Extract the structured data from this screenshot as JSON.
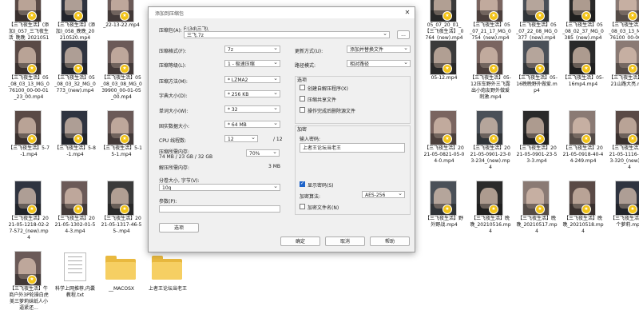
{
  "files": [
    {
      "name": "【三飞夜生活】(添加)_057_三飞夜生活_晚晚_20210518.mp4",
      "type": "video"
    },
    {
      "name": "【三飞夜生活】(添加)_058_晚晚_20210520.mp4",
      "type": "video"
    },
    {
      "name": "_22-13-22.mp4",
      "type": "video"
    },
    {
      "name": "05_07_20_01_【三飞夜生活】_0764_(new).mp4",
      "type": "video"
    },
    {
      "name": "【三飞夜生活】05_07_21_17_MG_0754_(new).mp4",
      "type": "video"
    },
    {
      "name": "【三飞夜生活】05_07_22_08_MG_0377_(new).mp4",
      "type": "video"
    },
    {
      "name": "【三飞夜生活】05_08_02_37_MG_0385_(new).mp4",
      "type": "video"
    },
    {
      "name": "【三飞夜生活】05_08_03_13_MG_076100_00-00-40_00.mp4",
      "type": "video"
    },
    {
      "name": "【三飞夜生活】05_08_03_13_MG_076100_00-00-01_23_00.mp4",
      "type": "video"
    },
    {
      "name": "【三飞夜生活】05_08_03_32_MG_0773_(new).mp4",
      "type": "video"
    },
    {
      "name": "【三飞夜生活】05_08_03_08_MG_039900_00-01-05_00.mp4",
      "type": "video"
    },
    {
      "name": "05-12.mp4",
      "type": "video"
    },
    {
      "name": "【三飞夜生活】05-12压车野外三飞露出小炮友野外做爱刺激.mp4",
      "type": "video"
    },
    {
      "name": "【三飞夜生活】05-16晚晚野外做爱.mp4",
      "type": "video"
    },
    {
      "name": "【三飞夜生活】05-16mp4.mp4",
      "type": "video"
    },
    {
      "name": "【三飞夜生活】05-21山路大亮.mp4",
      "type": "video"
    },
    {
      "name": "【三飞夜生活】5-7-1.mp4",
      "type": "video"
    },
    {
      "name": "【三飞夜生活】5-8-1.mp4",
      "type": "video"
    },
    {
      "name": "【三飞夜生活】5-15-1.mp4",
      "type": "video"
    },
    {
      "name": "【三飞夜生活】5-16.mp4",
      "type": "video"
    },
    {
      "name": "【三飞夜生活】2021-05-0821-05-04-0.mp4",
      "type": "video"
    },
    {
      "name": "【三飞夜生活】2021-05-0901-23-03-234_(new).mp4",
      "type": "video"
    },
    {
      "name": "【三飞夜生活】2021-05-0901-23-53-3.mp4",
      "type": "video"
    },
    {
      "name": "【三飞夜生活】2021-05-0918-40-44-249.mp4",
      "type": "video"
    },
    {
      "name": "【三飞夜生活】2021-05-1116-37-23-320_(new).mp4",
      "type": "video"
    },
    {
      "name": "【三飞夜生活】2021-05-1218-02-27-572_(new).mp4",
      "type": "video"
    },
    {
      "name": "【三飞夜生活】2021-05-1302-01-54-3.mp4",
      "type": "video"
    },
    {
      "name": "【三飞夜生活】2021-05-1317-46-55-.mp4",
      "type": "video"
    },
    {
      "name": "【三飞夜生活】42-5...",
      "type": "video"
    },
    {
      "name": "【三飞夜生活】野外野战.mp4",
      "type": "video"
    },
    {
      "name": "【三飞夜生活】晚晚_20210516.mp4",
      "type": "video"
    },
    {
      "name": "【三飞夜生活】晚晚_20210517.mp4",
      "type": "video"
    },
    {
      "name": "【三飞夜生活】晚晚_20210518.mp4",
      "type": "video"
    },
    {
      "name": "【三飞夜生活】三个萝莉.mp4",
      "type": "video"
    },
    {
      "name": "【三飞夜生活】牛商户外3P轮操白虎美三萝莉妹纸人小逼紧还...",
      "type": "video"
    },
    {
      "name": "科学上网推荐,内囊教程.txt",
      "type": "doc"
    },
    {
      "name": "__MACOSX",
      "type": "folder"
    },
    {
      "name": "上者王论坛当老王",
      "type": "folder"
    }
  ],
  "dialog": {
    "title": "添加到压缩包",
    "close_icon": "close-icon",
    "archive_label": "压缩包(A):",
    "archive_path": "F:\\3d\\三飞\\",
    "archive_name": "三飞.7z",
    "browse_label": "...",
    "format_label": "压缩格式(F):",
    "format_value": "7z",
    "level_label": "压缩等级(L):",
    "level_value": "1 - 极速压缩",
    "method_label": "压缩方法(M):",
    "method_value": "* LZMA2",
    "dict_label": "字典大小(D):",
    "dict_value": "* 256 KB",
    "word_label": "单词大小(W):",
    "word_value": "* 32",
    "solid_label": "固实数据大小:",
    "solid_value": "* 64 MB",
    "cpu_label": "CPU 线程数:",
    "cpu_value": "12",
    "cpu_max": "/ 12",
    "mem_label": "压缩所需内存:",
    "mem_detail": "74 MB / 23 GB / 32 GB",
    "mem_percent": "70%",
    "decomp_label": "解压所需内存:",
    "decomp_value": "3 MB",
    "split_label": "分卷大小, 字节(V):",
    "split_value": "10g",
    "params_label": "参数(P):",
    "params_value": "",
    "options_button": "选项",
    "update_label": "更新方式(U):",
    "update_value": "添加并替换文件",
    "pathmode_label": "路径模式:",
    "pathmode_value": "相对路径",
    "options_group": "选项",
    "opt_sfx": "创建自解压程序(X)",
    "opt_shared": "压缩共享文件",
    "opt_delete": "操作完成后删除源文件",
    "encrypt_group": "加密",
    "password_label": "输入密码:",
    "password_value": "上者王论坛当老王",
    "show_password": "显示密码(S)",
    "show_password_checked": true,
    "method_enc_label": "加密算法:",
    "method_enc_value": "AES-256",
    "encrypt_names": "加密文件名(N)",
    "ok_button": "确定",
    "cancel_button": "取消",
    "help_button": "帮助"
  }
}
